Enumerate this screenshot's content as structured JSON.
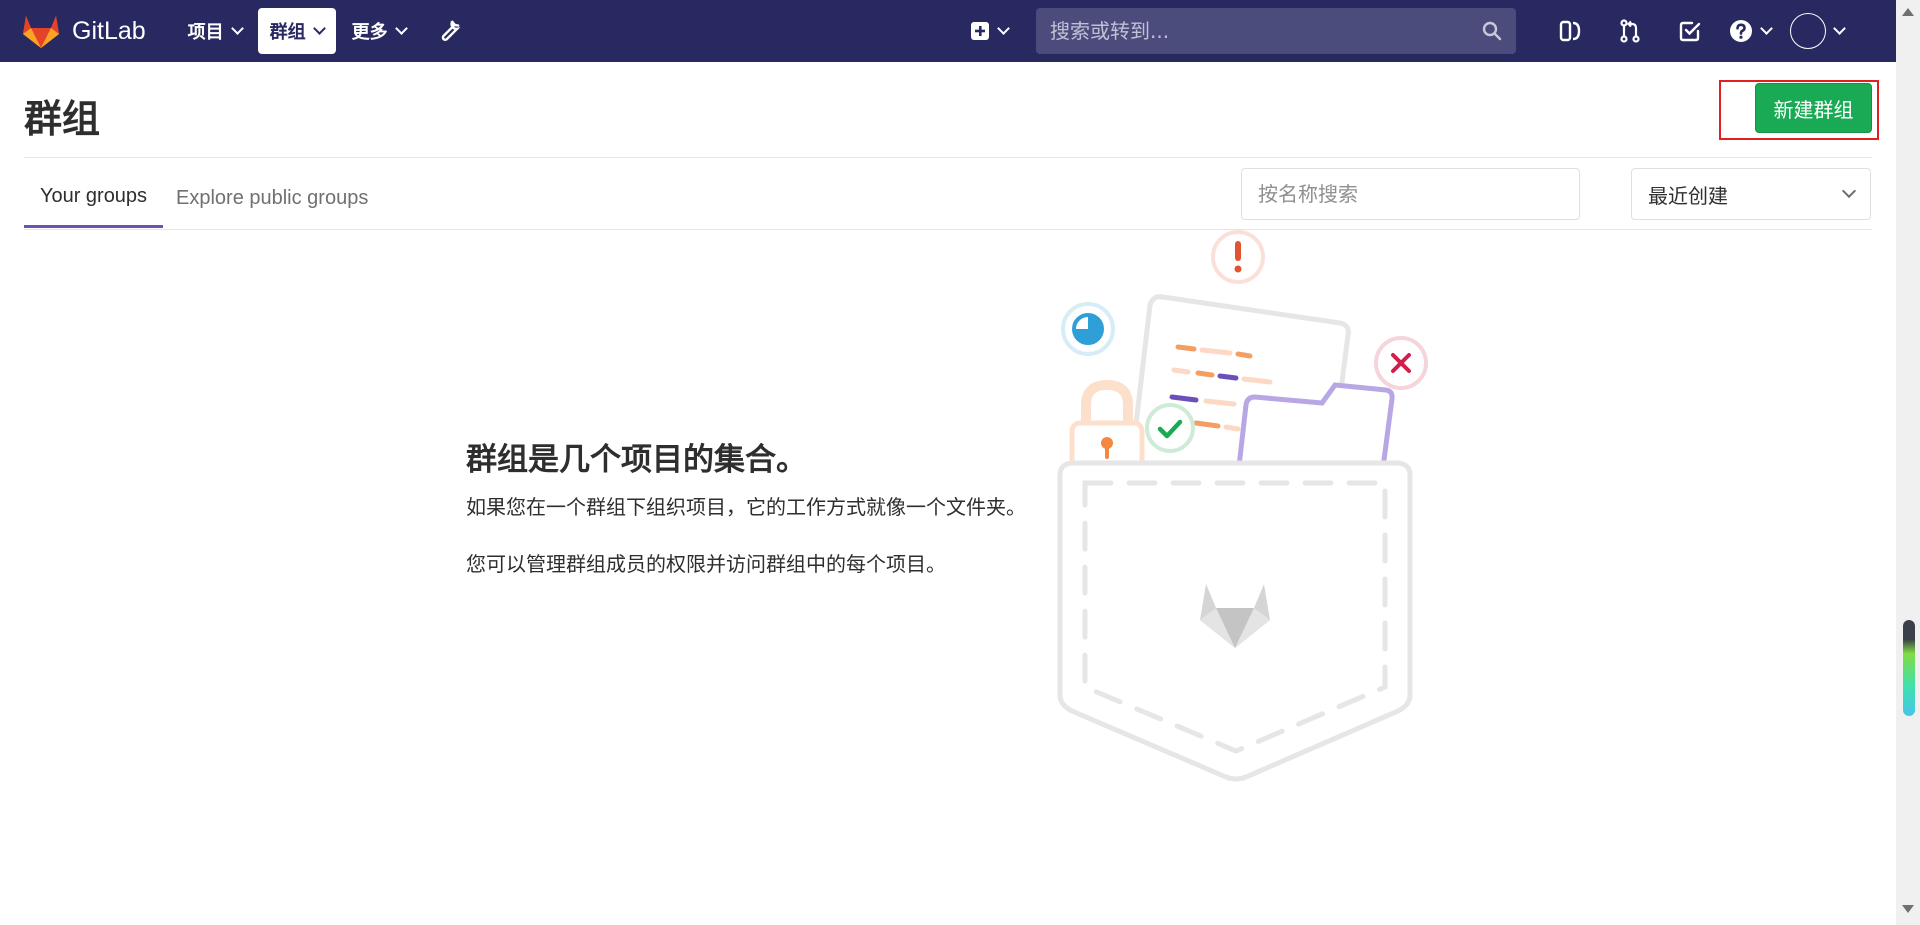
{
  "navbar": {
    "logo_text": "GitLab",
    "menu": [
      {
        "label": "项目"
      },
      {
        "label": "群组"
      },
      {
        "label": "更多"
      }
    ],
    "search_placeholder": "搜索或转到...",
    "bg_color": "#292961"
  },
  "header": {
    "title": "群组",
    "new_group_label": "新建群组"
  },
  "tabs": {
    "your_groups": "Your groups",
    "explore": "Explore public groups"
  },
  "filter": {
    "search_placeholder": "按名称搜索",
    "sort_selected": "最近创建"
  },
  "empty_state": {
    "title": "群组是几个项目的集合。",
    "line1": "如果您在一个群组下组织项目，它的工作方式就像一个文件夹。",
    "line2": "您可以管理群组成员的权限并访问群组中的每个项目。"
  },
  "colors": {
    "accent": "#6b4fbb",
    "primary_button": "#1aaa55",
    "highlight_border": "#e02020"
  }
}
